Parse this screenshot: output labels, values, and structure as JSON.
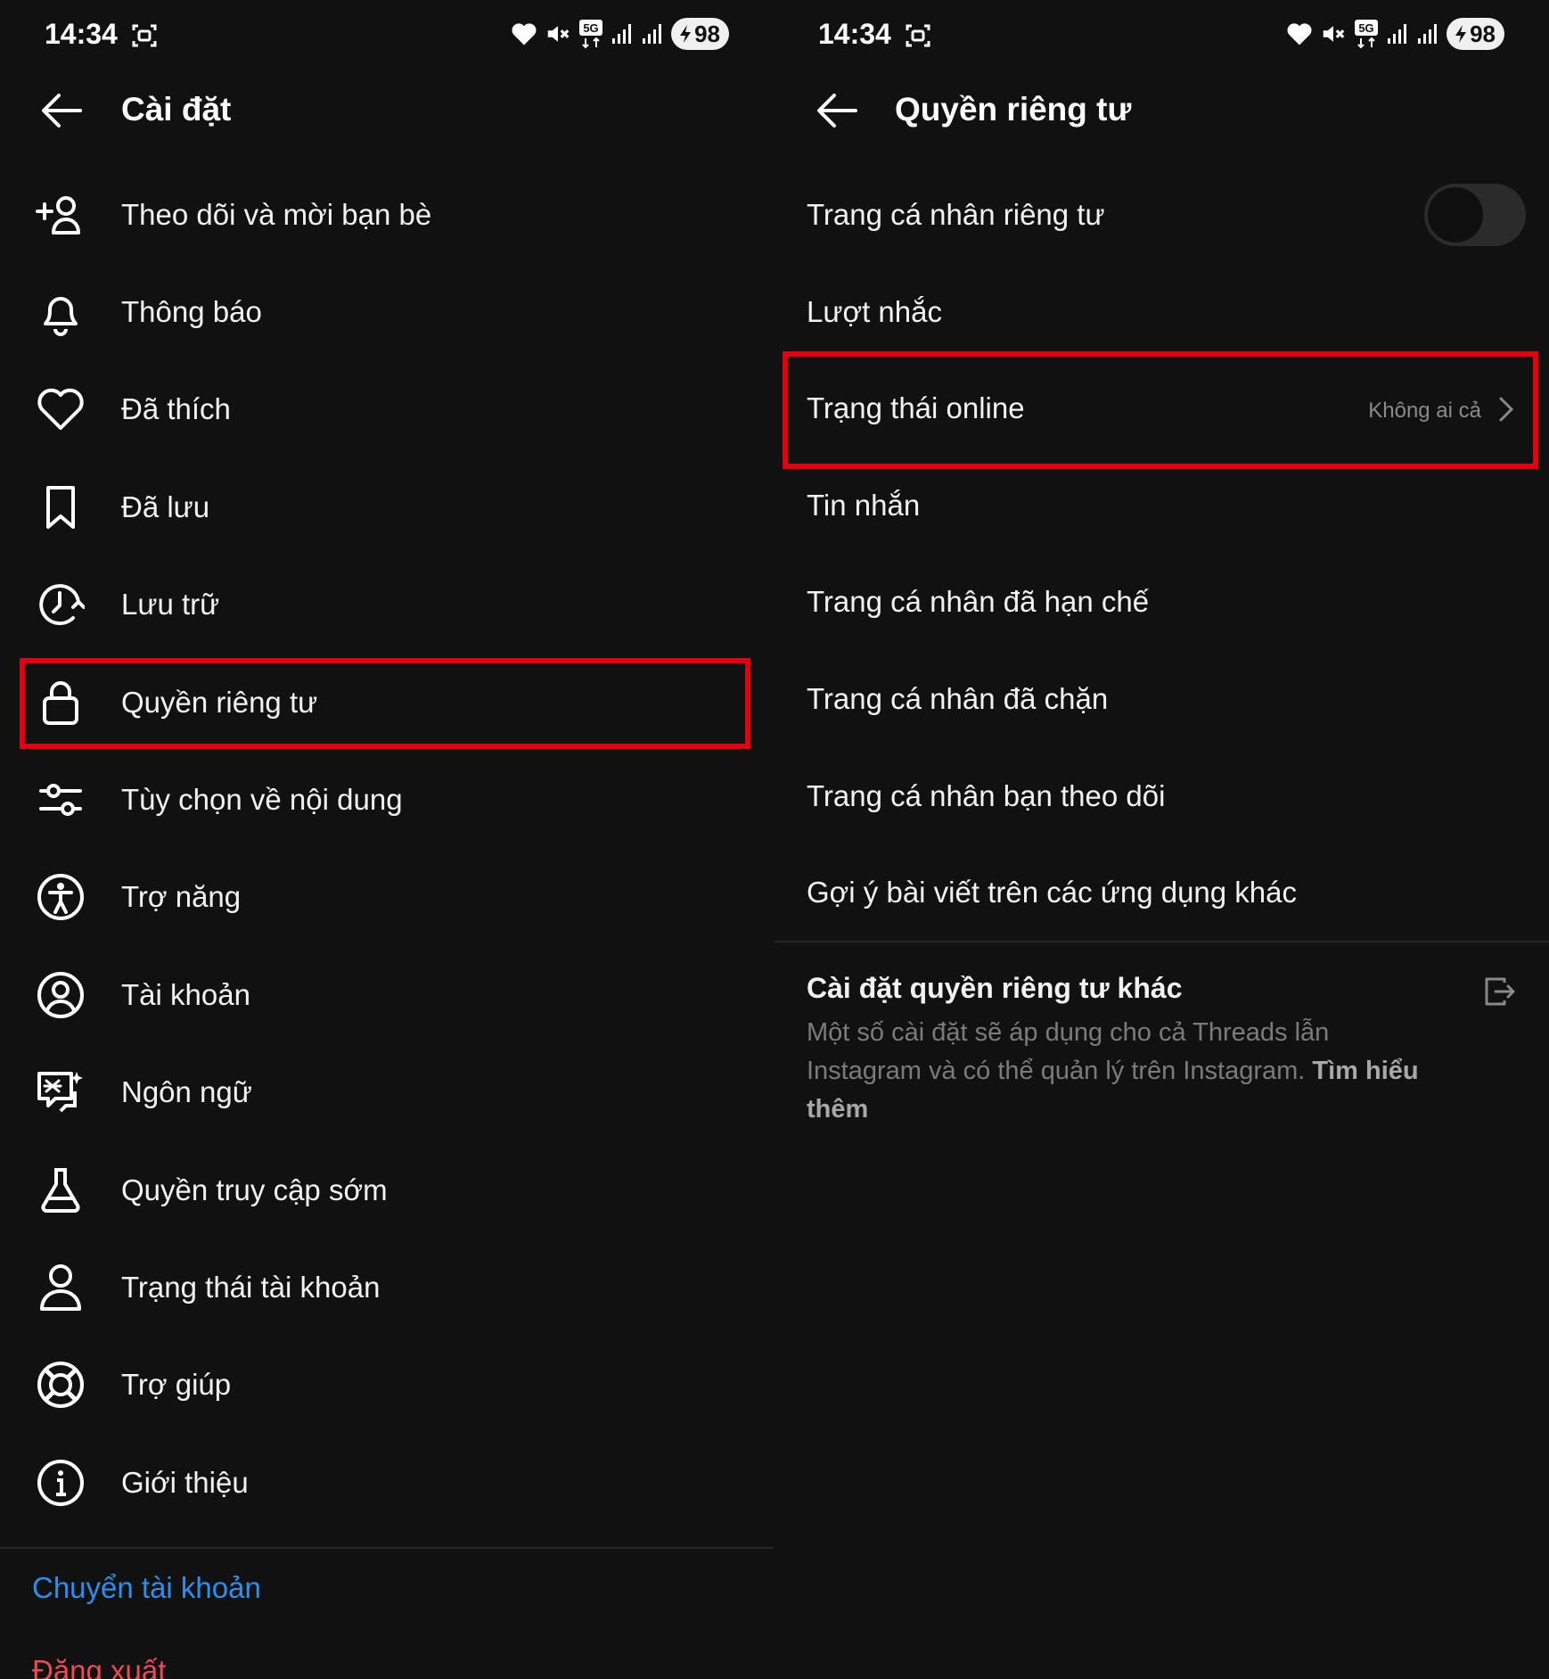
{
  "colors": {
    "background": "#111111",
    "highlight": "#e3000f",
    "link_blue": "#2a8ff0",
    "logout_red": "#ed4956"
  },
  "status_bar": {
    "time": "14:34",
    "network": "5G",
    "battery": "98"
  },
  "left_screen": {
    "title": "Cài đặt",
    "menu": [
      {
        "icon": "add-user-icon",
        "label": "Theo dõi và mời bạn bè"
      },
      {
        "icon": "bell-icon",
        "label": "Thông báo"
      },
      {
        "icon": "heart-icon",
        "label": "Đã thích"
      },
      {
        "icon": "bookmark-icon",
        "label": "Đã lưu"
      },
      {
        "icon": "archive-clock-icon",
        "label": "Lưu trữ"
      },
      {
        "icon": "lock-icon",
        "label": "Quyền riêng tư"
      },
      {
        "icon": "sliders-icon",
        "label": "Tùy chọn về nội dung"
      },
      {
        "icon": "accessibility-icon",
        "label": "Trợ năng"
      },
      {
        "icon": "account-circle-icon",
        "label": "Tài khoản"
      },
      {
        "icon": "translate-icon",
        "label": "Ngôn ngữ"
      },
      {
        "icon": "flask-icon",
        "label": "Quyền truy cập sớm"
      },
      {
        "icon": "person-icon",
        "label": "Trạng thái tài khoản"
      },
      {
        "icon": "lifebuoy-icon",
        "label": "Trợ giúp"
      },
      {
        "icon": "info-icon",
        "label": "Giới thiệu"
      }
    ],
    "switch_account": "Chuyển tài khoản",
    "logout": "Đăng xuất"
  },
  "right_screen": {
    "title": "Quyền riêng tư",
    "items": [
      {
        "label": "Trang cá nhân riêng tư",
        "toggle": false
      },
      {
        "label": "Lượt nhắc"
      },
      {
        "label": "Trạng thái online",
        "value": "Không ai cả"
      },
      {
        "label": "Tin nhắn"
      },
      {
        "label": "Trang cá nhân đã hạn chế"
      },
      {
        "label": "Trang cá nhân đã chặn"
      },
      {
        "label": "Trang cá nhân bạn theo dõi"
      },
      {
        "label": "Gợi ý bài viết trên các ứng dụng khác"
      }
    ],
    "other_settings": {
      "heading": "Cài đặt quyền riêng tư khác",
      "description": "Một số cài đặt sẽ áp dụng cho cả Threads lẫn Instagram và có thể quản lý trên Instagram.",
      "link": "Tìm hiểu thêm"
    }
  }
}
